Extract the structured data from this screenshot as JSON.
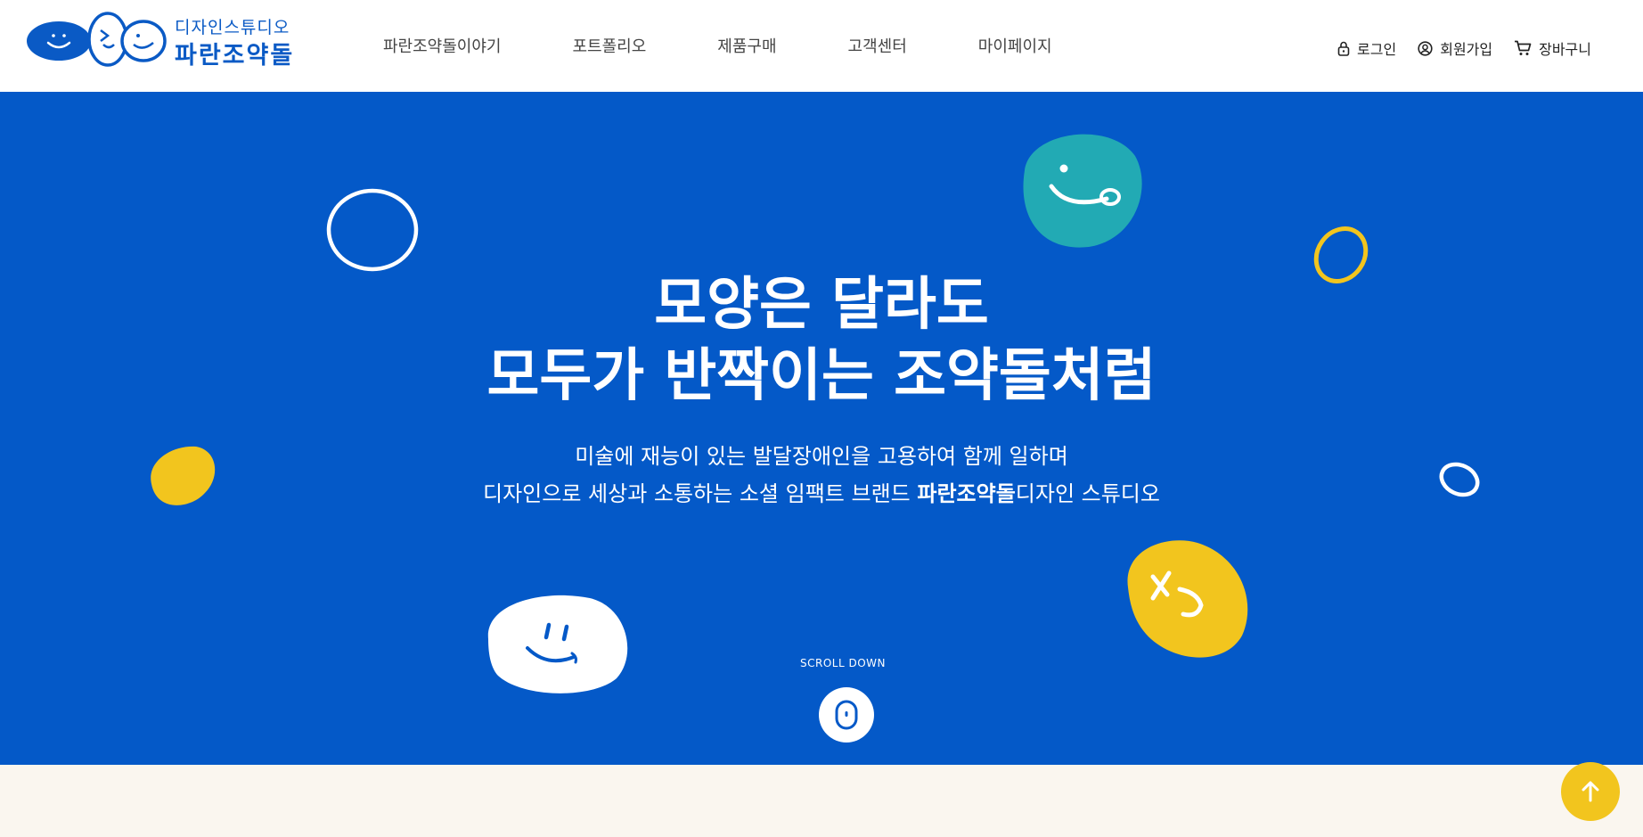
{
  "header": {
    "logo": {
      "sub": "디자인스튜디오",
      "main": "파란조약돌"
    },
    "nav": [
      "파란조약돌이야기",
      "포트폴리오",
      "제품구매",
      "고객센터",
      "마이페이지"
    ],
    "util": {
      "login": "로그인",
      "join": "회원가입",
      "cart": "장바구니"
    }
  },
  "hero": {
    "title_line1": "모양은 달라도",
    "title_line2": "모두가 반짝이는 조약돌처럼",
    "desc_line1": "미술에 재능이 있는 발달장애인을 고용하여 함께 일하며",
    "desc_line2_pre": "디자인으로 세상과 소통하는 소셜 임팩트 브랜드 ",
    "desc_line2_bold": "파란조약돌",
    "desc_line2_post": "디자인 스튜디오",
    "scroll_label": "SCROLL DOWN"
  },
  "colors": {
    "brand_blue": "#0459c8",
    "yellow": "#f2c51e",
    "teal": "#22aab4",
    "cream": "#faf6ef"
  },
  "icons": [
    "lock-icon",
    "user-circle-icon",
    "cart-icon",
    "mouse-icon",
    "arrow-up-icon"
  ]
}
